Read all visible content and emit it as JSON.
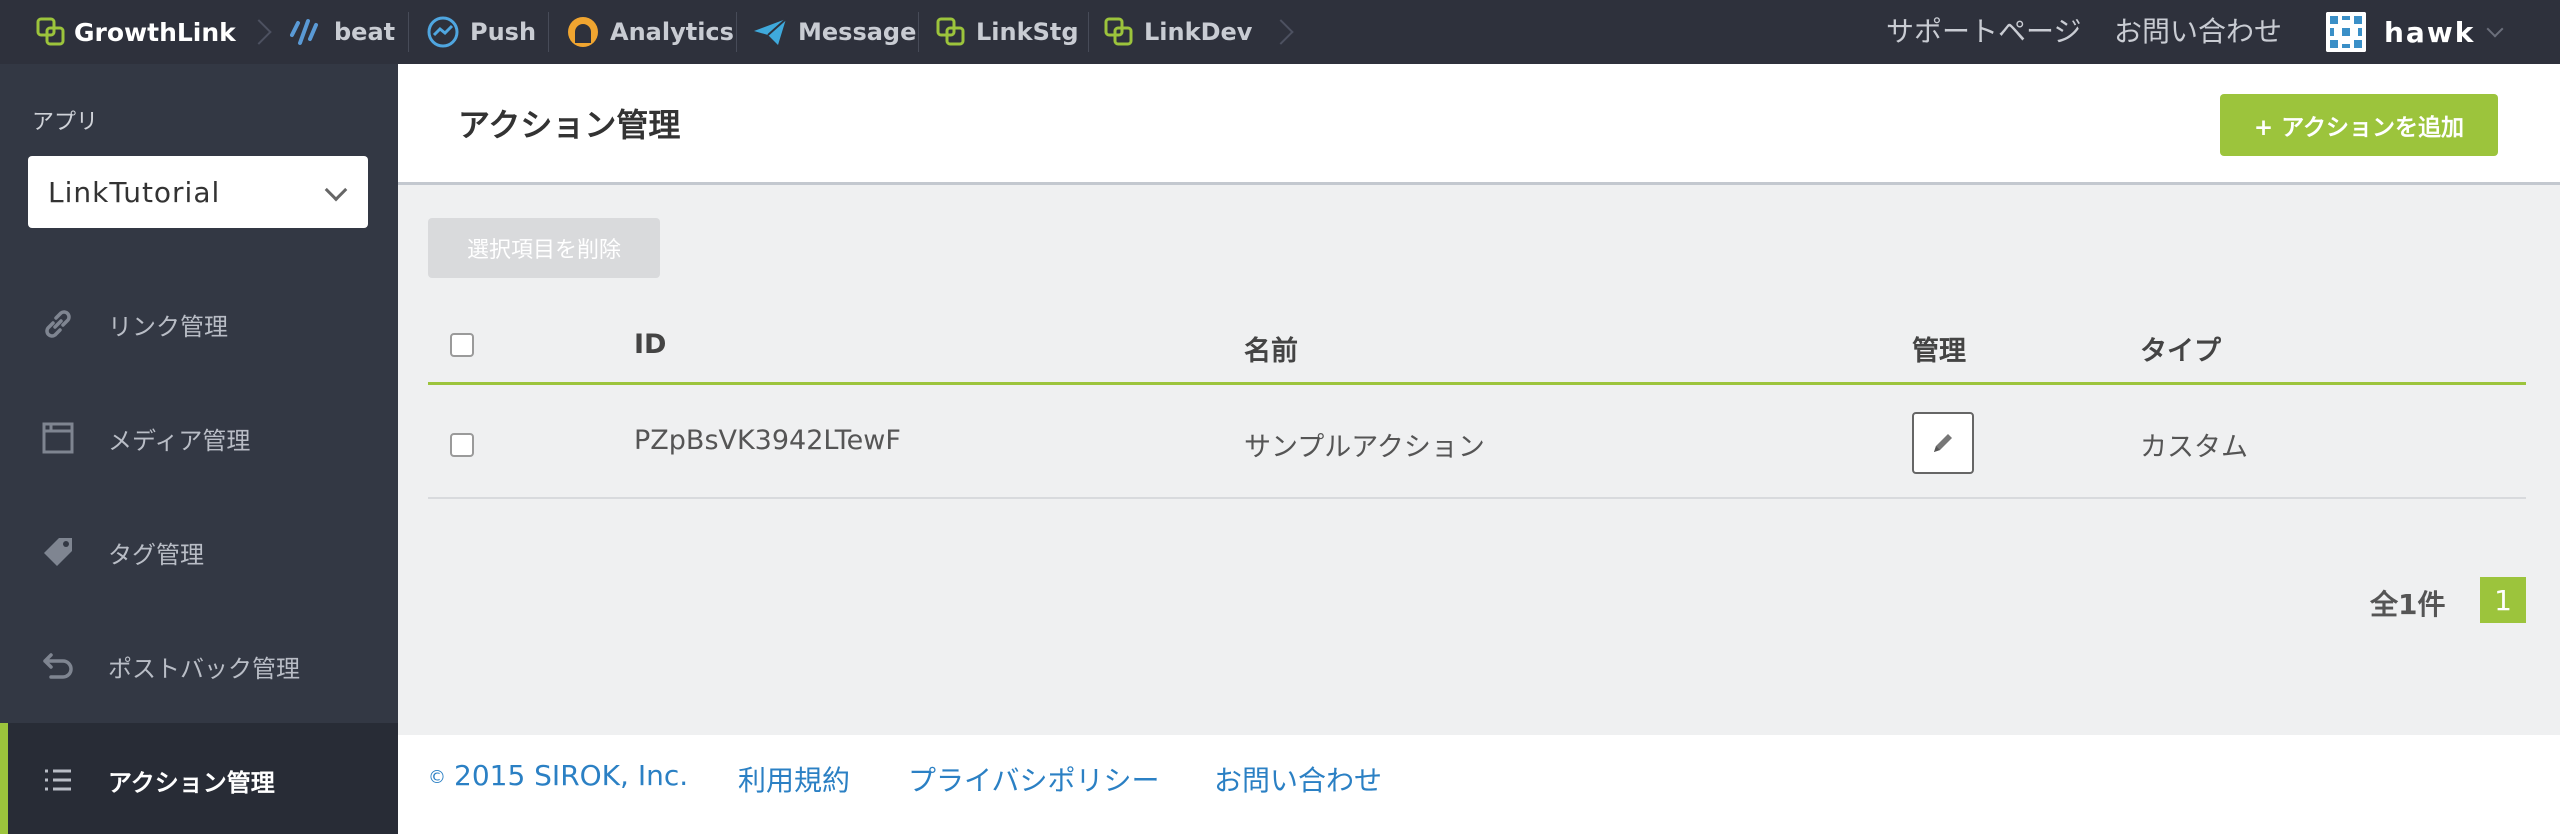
{
  "topbar": {
    "brand": "GrowthLink",
    "nav": [
      {
        "label": "beat",
        "icon": "beat-icon"
      },
      {
        "label": "Push",
        "icon": "push-icon"
      },
      {
        "label": "Analytics",
        "icon": "analytics-icon"
      },
      {
        "label": "Message",
        "icon": "message-icon"
      },
      {
        "label": "LinkStg",
        "icon": "link-icon"
      },
      {
        "label": "LinkDev",
        "icon": "link-icon"
      }
    ],
    "support": "サポートページ",
    "contact": "お問い合わせ",
    "user": "hawk"
  },
  "sidebar": {
    "app_label": "アプリ",
    "app_selected": "LinkTutorial",
    "items": [
      {
        "label": "リンク管理",
        "icon": "link-icon"
      },
      {
        "label": "メディア管理",
        "icon": "media-icon"
      },
      {
        "label": "タグ管理",
        "icon": "tag-icon"
      },
      {
        "label": "ポストバック管理",
        "icon": "postback-icon"
      },
      {
        "label": "アクション管理",
        "icon": "list-icon",
        "active": true
      }
    ]
  },
  "main": {
    "title": "アクション管理",
    "add_button": "+ アクションを追加",
    "delete_button": "選択項目を削除",
    "table": {
      "headers": [
        "ID",
        "名前",
        "管理",
        "タイプ"
      ],
      "rows": [
        {
          "id": "PZpBsVK3942LTewF",
          "name": "サンプルアクション",
          "type": "カスタム"
        }
      ]
    },
    "total": "全1件",
    "page": "1"
  },
  "footer": {
    "copyright_symbol": "©",
    "copyright": "2015 SIROK, Inc.",
    "links": [
      "利用規約",
      "プライバシポリシー",
      "お問い合わせ"
    ]
  },
  "colors": {
    "accent": "#9cc43c",
    "topbar": "#2e313c",
    "sidebar": "#333844",
    "link": "#2b80c4"
  }
}
